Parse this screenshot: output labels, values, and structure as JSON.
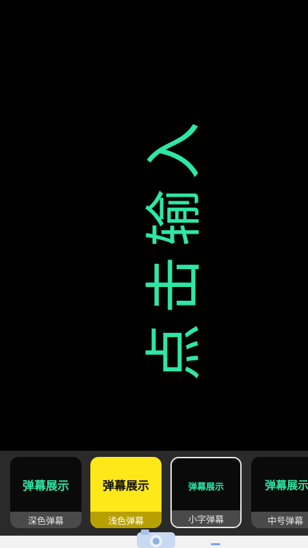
{
  "preview": {
    "text": "点击输入",
    "color": "#2ee6a6"
  },
  "styles": [
    {
      "sample": "弹幕展示",
      "label": "深色弹幕",
      "text_color": "#2ee6a6",
      "label_color": "#e6e6e6"
    },
    {
      "sample": "弹幕展示",
      "label": "浅色弹幕",
      "text_color": "#111111",
      "label_color": "#ffffff"
    },
    {
      "sample": "弹幕展示",
      "label": "小字弹幕",
      "text_color": "#2ee6a6",
      "label_color": "#e6e6e6"
    },
    {
      "sample": "弹幕展示",
      "label": "中号弹幕",
      "text_color": "#2ee6a6",
      "label_color": "#e6e6e6"
    }
  ],
  "icons": {
    "camera": "camera-icon"
  },
  "colors": {
    "background": "#000000",
    "bar": "#2a2a2a",
    "accent": "#2ee6a6",
    "highlight": "#ffe81a"
  }
}
